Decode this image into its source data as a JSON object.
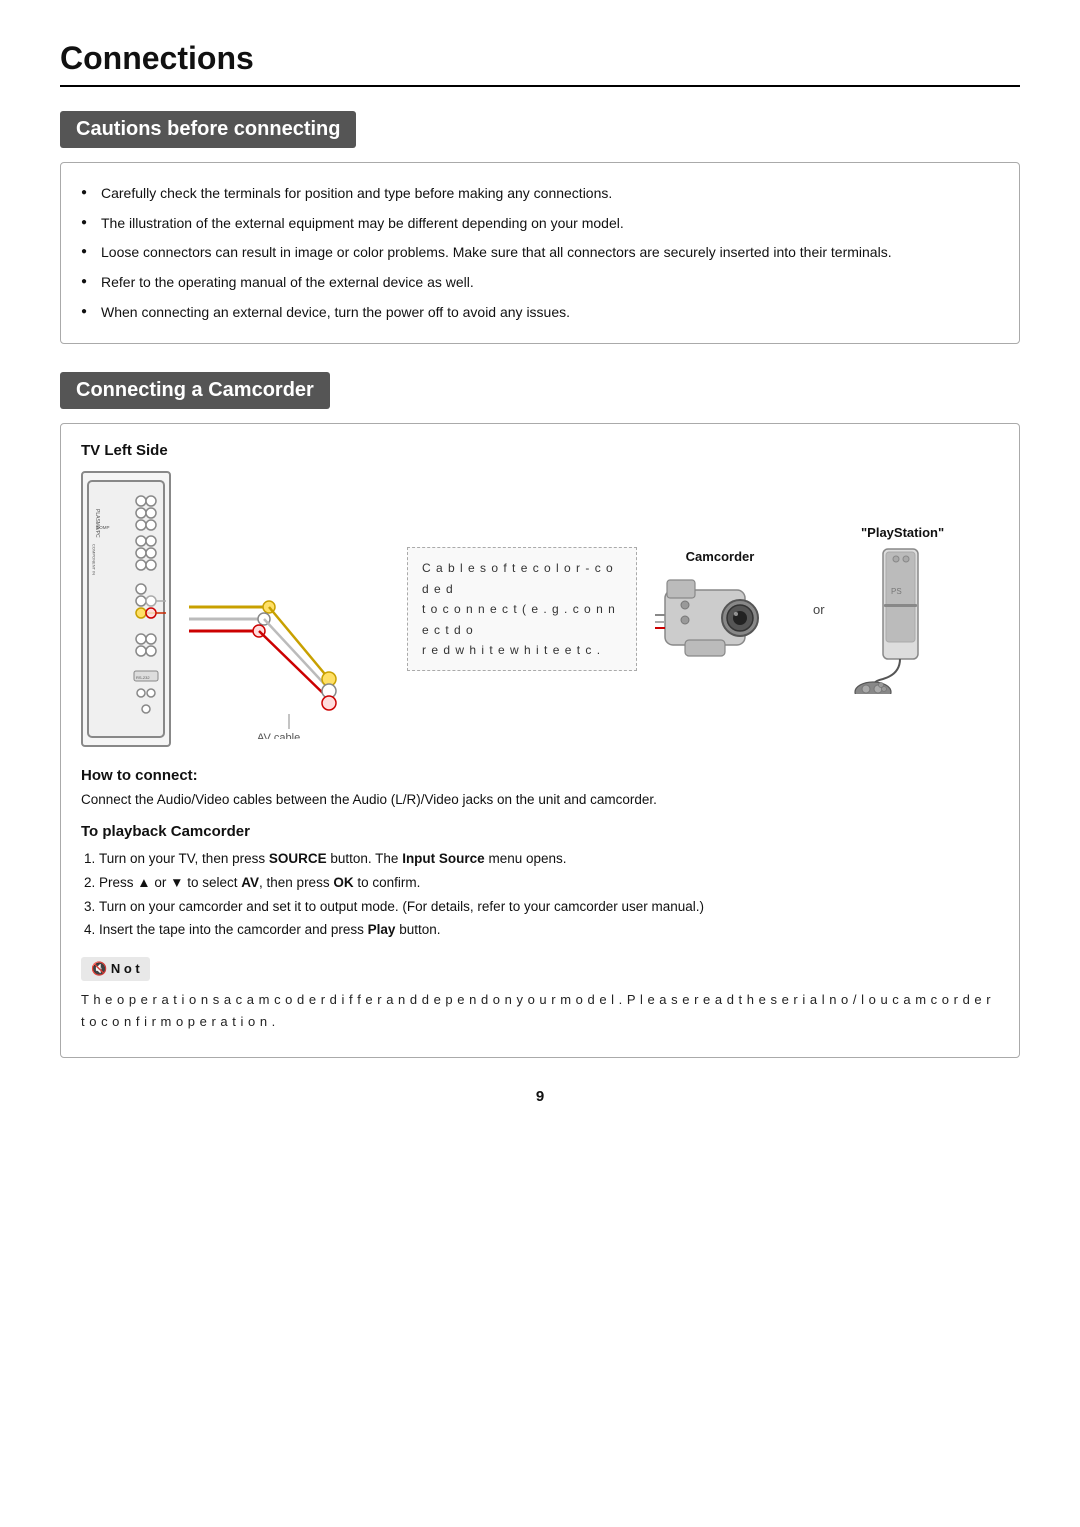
{
  "page": {
    "title": "Connections",
    "page_number": "9"
  },
  "cautions_section": {
    "heading": "Cautions before connecting",
    "items": [
      "Carefully check the terminals for position and type before making any connections.",
      "The illustration of the external equipment may be different depending on your model.",
      "Loose connectors can result in image or color problems. Make sure that all connectors are securely inserted into their terminals.",
      "Refer to the operating manual of the external device as well.",
      "When connecting an external device, turn the power off to avoid any issues."
    ]
  },
  "connecting_section": {
    "heading": "Connecting a Camcorder",
    "tv_left_side": "TV Left Side",
    "callout_text": "C a b l e s  o f  t e  c o l o r - c o d e d\nt o c o n n e c t  ( e . g .  c o n n e c t  d o\nr e d  w h i t e  w h i t e  e t c .",
    "camcorder_label": "Camcorder",
    "playstation_label": "\"PlayStation\"",
    "or_label": "or",
    "av_cable_label": "AV cable",
    "how_to_connect_heading": "How to connect:",
    "how_to_connect_text": "Connect the Audio/Video cables between the Audio (L/R)/Video jacks on the unit and camcorder.",
    "to_playback_heading": "To playback Camcorder",
    "steps": [
      "1. Turn on your TV, then press SOURCE button. The Input Source menu opens.",
      "2. Press ▲ or ▼ to select AV, then press OK to confirm.",
      "3. Turn on your camcorder and set it to output mode. (For details, refer to your camcorder user manual.)",
      "4. Insert the tape into the camcorder and press Play button."
    ],
    "note_label": "N o t",
    "note_text": "T h e  o p e r a t i o n s  a  c a m c o d e r  d i f f e r  a n d  d e p e n d  o n  y o u r  m o d e l .  P l e a s e  r e a d  t h e  s e r i a l  n o / l o u c a m c o r d e r\nt o  c o n f i r m  o p e r a t i o n ."
  }
}
